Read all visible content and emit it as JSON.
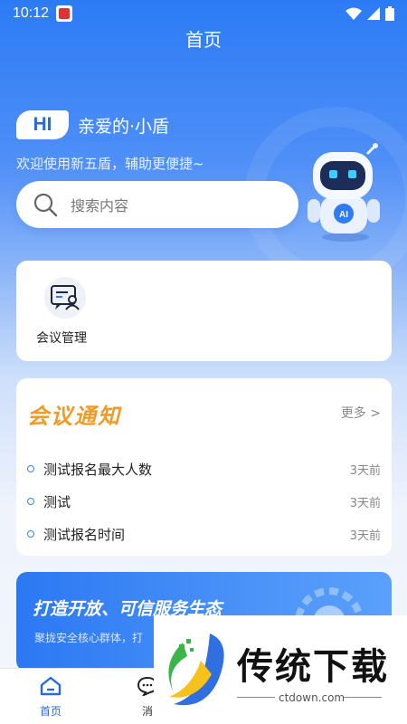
{
  "status": {
    "time": "10:12"
  },
  "header": {
    "title": "首页"
  },
  "greeting": {
    "badge": "HI",
    "name": "亲爱的·小盾",
    "welcome": "欢迎使用新五盾，辅助更便捷~"
  },
  "search": {
    "placeholder": "搜索内容"
  },
  "robot": {
    "badge": "AI"
  },
  "shortcuts": [
    {
      "label": "会议管理",
      "icon": "meeting-management-icon"
    }
  ],
  "notices": {
    "title": "会议通知",
    "more": "更多 >",
    "items": [
      {
        "text": "测试报名最大人数",
        "time": "3天前"
      },
      {
        "text": "测试",
        "time": "3天前"
      },
      {
        "text": "测试报名时间",
        "time": "3天前"
      }
    ]
  },
  "banner": {
    "title": "打造开放、可信服务生态",
    "subtitle": "聚拢安全核心群体，打"
  },
  "tabbar": {
    "items": [
      {
        "label": "首页"
      },
      {
        "label": "消"
      }
    ]
  },
  "watermark": {
    "text": "传统下载",
    "domain": "ctdown.com"
  },
  "colors": {
    "primary": "#2369e8",
    "accent": "#f09b28",
    "dot": "#3a82f0"
  }
}
